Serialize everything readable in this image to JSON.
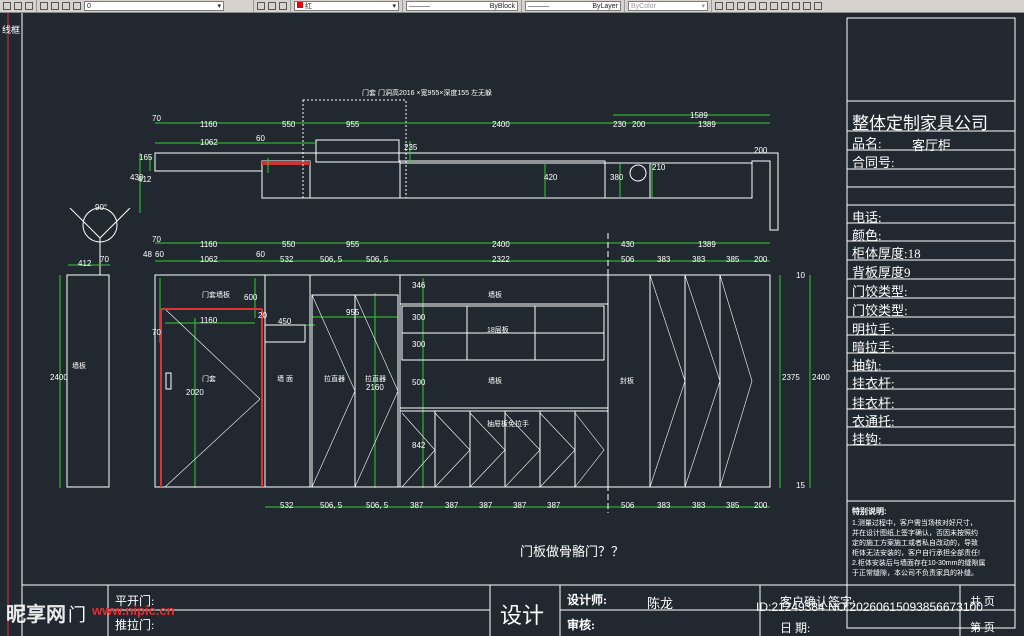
{
  "toolbar": {
    "layer_value": "0",
    "color_value": "红",
    "linetype": "ByBlock",
    "lineweight": "ByLayer",
    "plotstyle": "ByColor"
  },
  "viewport_label": "线框",
  "title_block": {
    "company": "整体定制家具公司",
    "product_label": "品名:",
    "product_value": "客厅柜",
    "contract_label": "合同号:",
    "phone_label": "电话:",
    "color_label": "颜色:",
    "thickness_label": "柜体厚度:18",
    "back_label": "背板厚度9",
    "hinge1_label": "门饺类型:",
    "hinge2_label": "门饺类型:",
    "handle1_label": "明拉手:",
    "handle2_label": "暗拉手:",
    "drawer_label": "抽轨:",
    "rod1_label": "挂衣杆:",
    "rod2_label": "挂衣杆:",
    "rod3_label": "衣通托:",
    "hook_label": "挂钩:",
    "notes_title": "特别说明:",
    "notes": [
      "1.测量过程中，客户需当场核对好尺寸，",
      "并在设计图纸上签字确认，否因未按照约",
      "定的施工方案施工或者私自改动的，导致",
      "柜体无法安装的，客户自行承担全部责任!",
      "2.柜体安装后与墙面存在10-30mm的缝隙属",
      "于正常缝隙，本公司不负责家具的补缝。"
    ]
  },
  "bottom_bar": {
    "door_type": "门",
    "flat_door": "平开门:",
    "slide_door": "推拉门:",
    "design": "设计",
    "designer_label": "设计师:",
    "designer_name": "陈龙",
    "review_label": "审核:",
    "client_sign": "客户确认签字:",
    "date_label": "日    期:",
    "total_pages": "共    页",
    "page_label": "第    页"
  },
  "drawing": {
    "top_note": "门套  门洞高2016  ×宽955×深度155  左无躲",
    "question": "门板做骨骼门？？",
    "plan_dims_row1": [
      "70",
      "1160",
      "550",
      "955",
      "2400",
      "230",
      "200",
      "1589",
      "1389"
    ],
    "plan_dims_row2": [
      "1062",
      "60"
    ],
    "plan_side_dims": [
      "165",
      "430",
      "412",
      "235",
      "420",
      "380",
      "210",
      "200"
    ],
    "elev_dims_row1": [
      "70",
      "1160",
      "550",
      "955",
      "2400",
      "430",
      "1389"
    ],
    "elev_dims_row2": [
      "48",
      "60",
      "1062",
      "60",
      "532",
      "506, 5",
      "506, 5",
      "2322",
      "506",
      "383",
      "383",
      "385",
      "200"
    ],
    "elev_bottom_dims": [
      "532",
      "506, 5",
      "506, 5",
      "387",
      "387",
      "387",
      "387",
      "387",
      "506",
      "383",
      "383",
      "385",
      "200"
    ],
    "elev_inner_dims": [
      "600",
      "1160",
      "70",
      "20",
      "450",
      "955",
      "2020",
      "2160",
      "346",
      "300",
      "300",
      "500",
      "842"
    ],
    "elev_height_dims": [
      "2400",
      "2400",
      "2375",
      "10",
      "15"
    ],
    "left_panel_dims": [
      "412",
      "70",
      "2400"
    ],
    "circle_label": "90°",
    "labels": {
      "door_frame_board": "门套墙板",
      "door_frame": "门套",
      "wall": "墙  面",
      "sliding_rail1": "拉直器",
      "sliding_rail2": "拉直器",
      "wall_board_top": "墙板",
      "layer_board": "18层板",
      "wall_board_mid": "墙板",
      "drawer_pull": "抽屉板免拉手",
      "sealing_board": "封板",
      "left_wall_board": "墙板"
    }
  },
  "watermark": {
    "logo": "昵享网",
    "url": "www.nipic.cn",
    "id": "ID:21249384 NO:20260615093856673100"
  }
}
